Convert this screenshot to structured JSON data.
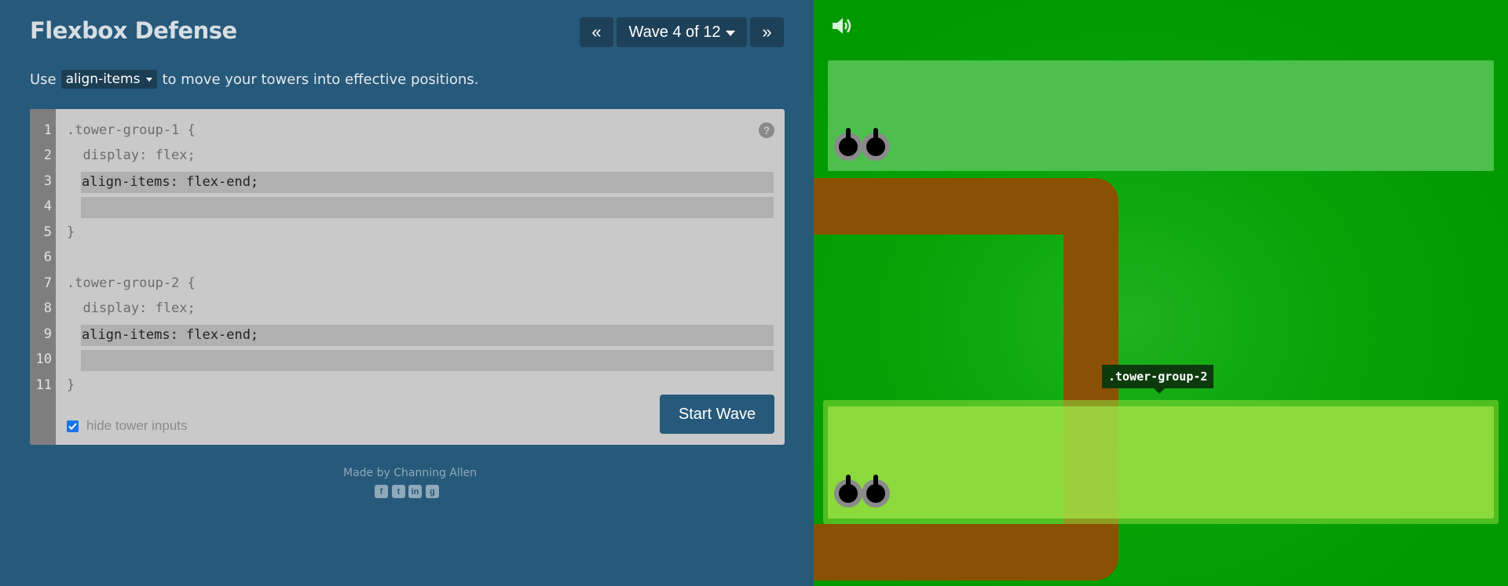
{
  "header": {
    "title": "Flexbox Defense",
    "prev_label": "«",
    "wave_label": "Wave 4 of 12",
    "next_label": "»"
  },
  "instructions": {
    "prefix": "Use",
    "property": "align-items",
    "suffix": "to move your towers into effective positions."
  },
  "editor": {
    "line_numbers": [
      "1",
      "2",
      "3",
      "4",
      "5",
      "6",
      "7",
      "8",
      "9",
      "10",
      "11"
    ],
    "lines": [
      ".tower-group-1 {",
      "  display: flex;",
      "align-items: flex-end;",
      "",
      "}",
      "",
      ".tower-group-2 {",
      "  display: flex;",
      "align-items: flex-end;",
      "",
      "}"
    ],
    "help_label": "?",
    "hide_inputs_label": "hide tower inputs",
    "hide_inputs_checked": true,
    "start_label": "Start Wave"
  },
  "footer": {
    "credit": "Made by Channing Allen",
    "social": [
      "facebook-icon",
      "twitter-icon",
      "linkedin-icon",
      "github-icon"
    ]
  },
  "game": {
    "tooltip": ".tower-group-2",
    "colors": {
      "grass": "#009900",
      "path": "#8a5104",
      "group1_zone": "#4cbf4c",
      "group2_zone": "#8fdc3a"
    }
  }
}
